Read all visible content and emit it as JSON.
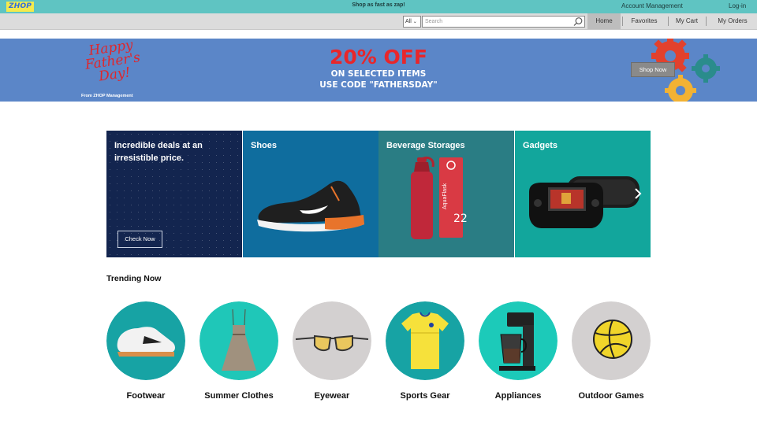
{
  "topbar": {
    "logo": "ZHOP",
    "tagline": "Shop as fast as zap!",
    "account_label": "Account Management",
    "login_label": "Log-in"
  },
  "navbar": {
    "category_select": "All",
    "search_placeholder": "Search",
    "items": [
      {
        "label": "Home"
      },
      {
        "label": "Favorites"
      },
      {
        "label": "My Cart"
      },
      {
        "label": "My Orders"
      }
    ]
  },
  "banner": {
    "greeting": "Happy Father's Day!",
    "from": "From ZHOP Management",
    "discount": "20% OFF",
    "line1": "ON SELECTED ITEMS",
    "line2": "USE CODE \"FATHERSDAY\"",
    "shop_now": "Shop Now"
  },
  "deals": {
    "title": "Incredible deals at an irresistible price.",
    "button": "Check Now"
  },
  "categories": [
    {
      "title": "Shoes",
      "icon": "sneaker-image"
    },
    {
      "title": "Beverage Storages",
      "icon": "water-bottle-image"
    },
    {
      "title": "Gadgets",
      "icon": "handheld-console-image"
    }
  ],
  "trending": {
    "title": "Trending Now",
    "items": [
      {
        "label": "Footwear",
        "color": "#17a3a4"
      },
      {
        "label": "Summer Clothes",
        "color": "#1fc7b8"
      },
      {
        "label": "Eyewear",
        "color": "#d3d0d0"
      },
      {
        "label": "Sports Gear",
        "color": "#17a3a4"
      },
      {
        "label": "Appliances",
        "color": "#1ccab9"
      },
      {
        "label": "Outdoor Games",
        "color": "#d3d0d0"
      }
    ]
  },
  "colors": {
    "topbar": "#5fc4c2",
    "banner": "#5b86c8",
    "accent_red": "#e8262b"
  }
}
